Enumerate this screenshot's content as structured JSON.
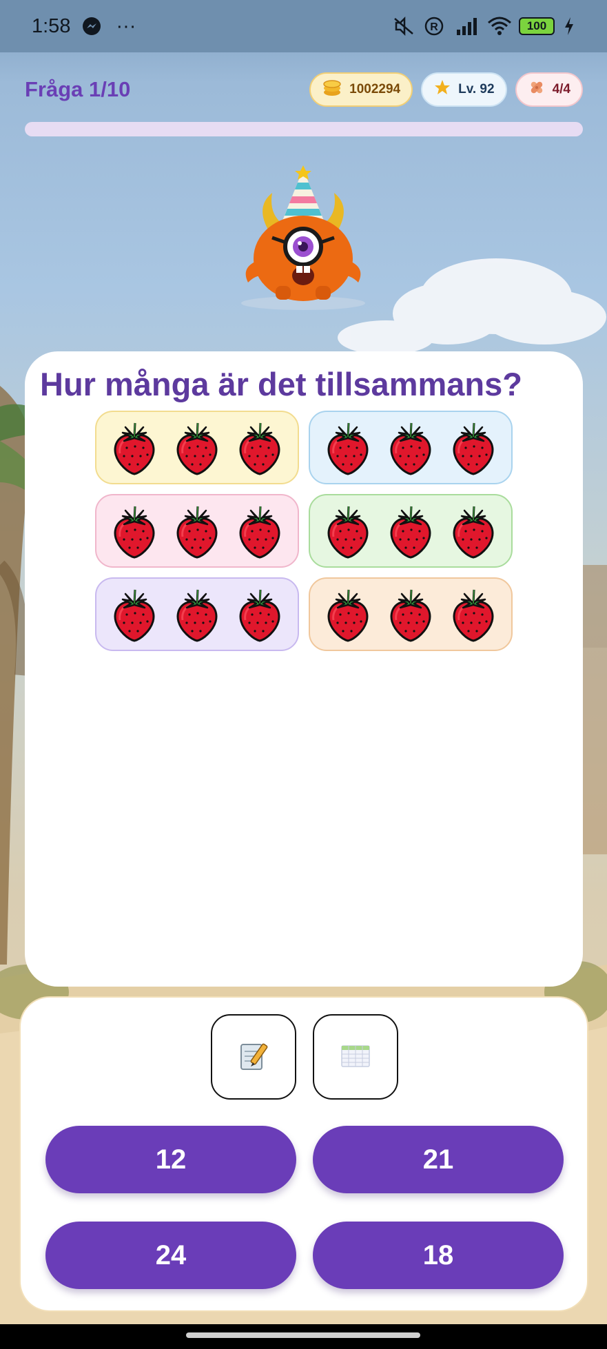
{
  "status_bar": {
    "time": "1:58",
    "more": "···",
    "battery": "100",
    "icons": [
      "messenger-icon",
      "mute-icon",
      "registered-icon",
      "signal-icon",
      "wifi-icon",
      "charging-icon"
    ]
  },
  "header": {
    "question_counter": "Fråga 1/10",
    "coins": "1002294",
    "level": "Lv. 92",
    "lives": "4/4",
    "progress_fraction": 0
  },
  "question": {
    "text": "Hur många är det tillsammans?",
    "groups": [
      {
        "count": 3,
        "bg": "#fdf6d2",
        "border": "#f2dc8f"
      },
      {
        "count": 3,
        "bg": "#e4f2fc",
        "border": "#a9d3ee"
      },
      {
        "count": 3,
        "bg": "#fde6ef",
        "border": "#f0b6cb"
      },
      {
        "count": 3,
        "bg": "#e6f7e1",
        "border": "#a9dc9c"
      },
      {
        "count": 3,
        "bg": "#ece6fb",
        "border": "#c8b9ef"
      },
      {
        "count": 3,
        "bg": "#fcebd9",
        "border": "#f0c79c"
      }
    ],
    "item_icon": "strawberry-icon"
  },
  "tools": [
    {
      "icon": "notepad-pencil-icon"
    },
    {
      "icon": "times-table-icon"
    }
  ],
  "answers": [
    "12",
    "21",
    "24",
    "18"
  ],
  "colors": {
    "accent": "#6a3db8",
    "title": "#6a3fb5",
    "question": "#5d3a9e"
  }
}
